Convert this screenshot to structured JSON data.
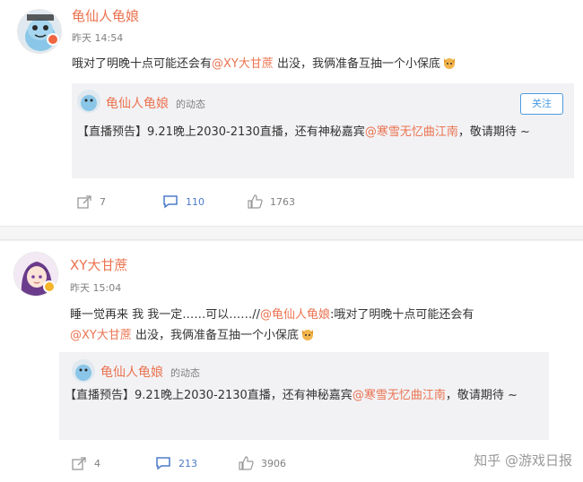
{
  "posts": [
    {
      "author": "龟仙人龟娘",
      "time": "昨天 14:54",
      "text_before": "哦对了明晚十点可能还会有",
      "mention": "@XY大甘蔗",
      "text_after": " 出没，我俩准备互抽一个小保底",
      "card": {
        "name": "龟仙人龟娘",
        "tag": "的动态",
        "follow_label": "关注",
        "text_before": "【直播预告】9.21晚上2030-2130直播，还有神秘嘉宾",
        "mention": "@寒雪无忆曲江南",
        "text_after": "，敬请期待 ~"
      },
      "actions": {
        "share": "7",
        "comment": "110",
        "like": "1763"
      }
    },
    {
      "author": "XY大甘蔗",
      "time": "昨天 15:04",
      "line1_before": "睡一觉再来 我 我一定……可以……//",
      "line1_mention": "@龟仙人龟娘",
      "line1_after": ":哦对了明晚十点可能还会有",
      "line2_mention": "@XY大甘蔗",
      "line2_after": " 出没，我俩准备互抽一个小保底",
      "card": {
        "name": "龟仙人龟娘",
        "tag": "的动态",
        "text_before": "【直播预告】9.21晚上2030-2130直播，还有神秘嘉宾",
        "mention": "@寒雪无忆曲江南",
        "text_after": "，敬请期待 ~"
      },
      "actions": {
        "share": "4",
        "comment": "213",
        "like": "3906"
      }
    }
  ],
  "watermark": "知乎 @游戏日报",
  "colors": {
    "accent": "#eb7350",
    "link": "#4c7bc9",
    "muted": "#808080",
    "card_bg": "#f2f2f5"
  }
}
